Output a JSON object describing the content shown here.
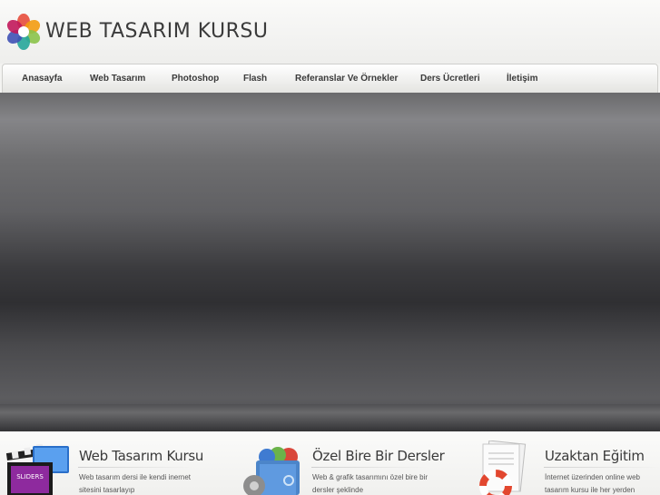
{
  "header": {
    "logo_text": "WEB TASARIM KURSU"
  },
  "nav": {
    "items": [
      "Anasayfa",
      "Web Tasarım",
      "Photoshop",
      "Flash",
      "Referanslar Ve Örnekler",
      "Ders Ücretleri",
      "İletişim"
    ]
  },
  "features": [
    {
      "title": "Web Tasarım Kursu",
      "desc": "Web tasarım dersi ile kendi inernet sitesini tasarlayıp",
      "icon": "film-clapper-icon",
      "icon_label": "SLIDERS"
    },
    {
      "title": "Özel Bire Bir Dersler",
      "desc": "Web & grafik tasarımını özel bire bir dersler şeklinde",
      "icon": "gear-box-icon"
    },
    {
      "title": "Uzaktan Eğitim",
      "desc": "İnternet üzerinden online web tasarım kursu ile her yerden",
      "icon": "lifebuoy-documents-icon"
    }
  ],
  "colors": {
    "text_dark": "#3a3a3a",
    "slider_dark": "#2f2f32",
    "slider_light": "#858588"
  }
}
